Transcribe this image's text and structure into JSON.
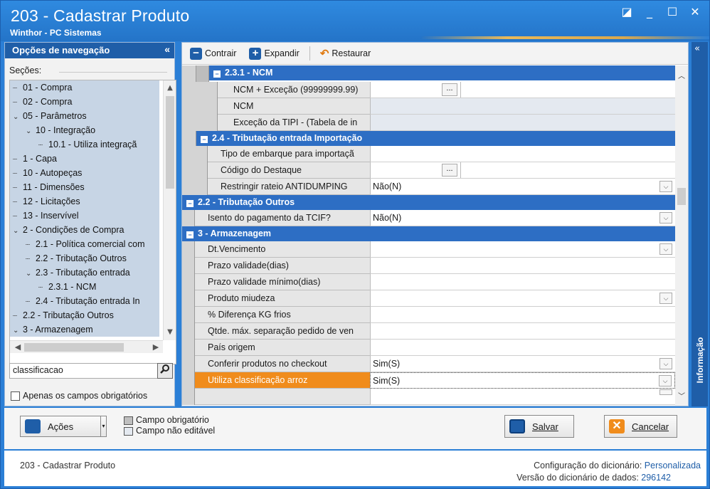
{
  "window": {
    "title": "203 - Cadastrar  Produto",
    "subtitle": "Winthor - PC Sistemas"
  },
  "nav": {
    "header": "Opções de navegação",
    "sections_label": "Seções:",
    "tree": [
      {
        "label": "01 - Compra",
        "depth": 0
      },
      {
        "label": "02 - Compra",
        "depth": 0
      },
      {
        "label": "05 - Parâmetros",
        "depth": 0,
        "expanded": true
      },
      {
        "label": "10 - Integração",
        "depth": 1,
        "expanded": true
      },
      {
        "label": "10.1 - Utiliza integraçã",
        "depth": 2
      },
      {
        "label": "1 - Capa",
        "depth": 0
      },
      {
        "label": "10 - Autopeças",
        "depth": 0
      },
      {
        "label": "11 - Dimensões",
        "depth": 0
      },
      {
        "label": "12 - Licitações",
        "depth": 0
      },
      {
        "label": "13 - Inservível",
        "depth": 0
      },
      {
        "label": "2 - Condições de Compra",
        "depth": 0,
        "expanded": true
      },
      {
        "label": "2.1 - Política comercial com",
        "depth": 1
      },
      {
        "label": "2.2 - Tributação Outros",
        "depth": 1
      },
      {
        "label": "2.3 - Tributação entrada",
        "depth": 1,
        "expanded": true
      },
      {
        "label": "2.3.1 - NCM",
        "depth": 2
      },
      {
        "label": "2.4 - Tributação entrada In",
        "depth": 1
      },
      {
        "label": "2.2 - Tributação Outros",
        "depth": 0
      },
      {
        "label": "3 - Armazenagem",
        "depth": 0,
        "expanded": true
      }
    ],
    "search_value": "classificacao",
    "required_only_label": "Apenas os campos obrigatórios"
  },
  "toolbar": {
    "collapse": "Contrair",
    "expand": "Expandir",
    "restore": "Restaurar"
  },
  "grid": {
    "cat_ncm": "2.3.1 - NCM",
    "ncm_exc": "NCM + Exceção (99999999.99)",
    "ncm": "NCM",
    "exc_tipi": "Exceção da TIPI - (Tabela de in",
    "cat_imp": "2.4 - Tributação entrada Importação",
    "tipo_emb": "Tipo de embarque para importaçã",
    "cod_dest": "Código do Destaque",
    "restr": "Restringir rateio ANTIDUMPING",
    "restr_val": "Não(N)",
    "cat_out": "2.2 - Tributação Outros",
    "isento": "Isento do pagamento da TCIF?",
    "isento_val": "Não(N)",
    "cat_arm": "3 - Armazenagem",
    "dtvenc": "Dt.Vencimento",
    "prazo": "Prazo validade(dias)",
    "prazo_min": "Prazo validade mínimo(dias)",
    "miudeza": "Produto miudeza",
    "dif_kg": "% Diferença KG frios",
    "qtde": "Qtde. máx. separação pedido de ven",
    "pais": "País origem",
    "conferir": "Conferir produtos no checkout",
    "conferir_val": "Sim(S)",
    "arroz": "Utiliza classificação arroz",
    "arroz_val": "Sim(S)",
    "ellipsis": "..."
  },
  "info_label": "Informação",
  "bottom": {
    "actions": "Ações",
    "legend_required": "Campo obrigatório",
    "legend_readonly": "Campo não editável",
    "save": "Salvar",
    "cancel": "Cancelar"
  },
  "status": {
    "left": "203 - Cadastrar  Produto",
    "dict_config_label": "Configuração do dicionário:",
    "dict_config_value": "Personalizada",
    "dict_version_label": "Versão do dicionário de dados:",
    "dict_version_value": "296142"
  },
  "colors": {
    "header_blue": "#1f5ea8",
    "category_blue": "#2d6ec4",
    "highlight_orange": "#f08c1c"
  }
}
